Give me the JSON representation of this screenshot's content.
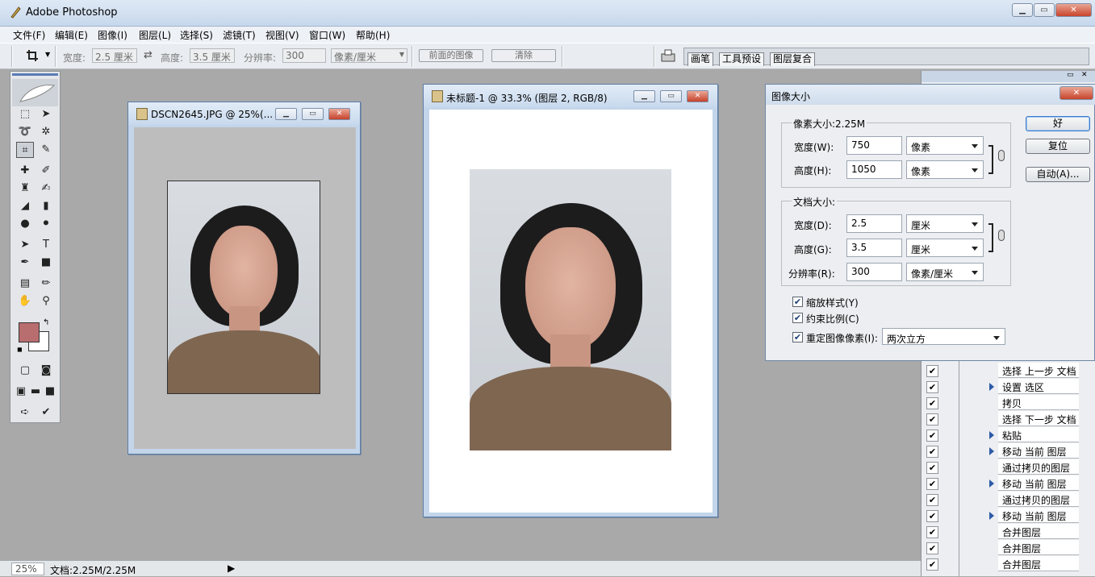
{
  "app": {
    "title": "Adobe Photoshop"
  },
  "menu": [
    "文件(F)",
    "编辑(E)",
    "图像(I)",
    "图层(L)",
    "选择(S)",
    "滤镜(T)",
    "视图(V)",
    "窗口(W)",
    "帮助(H)"
  ],
  "options": {
    "width_label": "宽度:",
    "width_value": "2.5 厘米",
    "height_label": "高度:",
    "height_value": "3.5 厘米",
    "resolution_label": "分辨率:",
    "resolution_value": "300",
    "unit_value": "像素/厘米",
    "front_image": "前面的图像",
    "clear": "清除"
  },
  "well_tabs": [
    "画笔",
    "工具预设",
    "图层复合"
  ],
  "doc1": {
    "title": "DSCN2645.JPG @ 25%(..."
  },
  "doc2": {
    "title": "未标题-1 @ 33.3% (图层 2, RGB/8)"
  },
  "dialog": {
    "title": "图像大小",
    "pixel_group": "像素大小:2.25M",
    "width_label": "宽度(W):",
    "width_value": "750",
    "width_unit": "像素",
    "height_label": "高度(H):",
    "height_value": "1050",
    "height_unit": "像素",
    "doc_group": "文档大小:",
    "doc_width_label": "宽度(D):",
    "doc_width_value": "2.5",
    "doc_width_unit": "厘米",
    "doc_height_label": "高度(G):",
    "doc_height_value": "3.5",
    "doc_height_unit": "厘米",
    "res_label": "分辨率(R):",
    "res_value": "300",
    "res_unit": "像素/厘米",
    "scale_styles": "缩放样式(Y)",
    "constrain": "约束比例(C)",
    "resample": "重定图像像素(I):",
    "resample_method": "两次立方",
    "ok": "好",
    "reset": "复位",
    "auto": "自动(A)..."
  },
  "history": [
    "选择 上一步 文档",
    "设置 选区",
    "拷贝",
    "选择 下一步 文档",
    "粘贴",
    "移动 当前 图层",
    "通过拷贝的图层",
    "移动 当前 图层",
    "通过拷贝的图层",
    "移动 当前 图层",
    "合并图层",
    "合并图层",
    "合并图层"
  ],
  "status": {
    "zoom": "25%",
    "doc": "文档:2.25M/2.25M"
  }
}
